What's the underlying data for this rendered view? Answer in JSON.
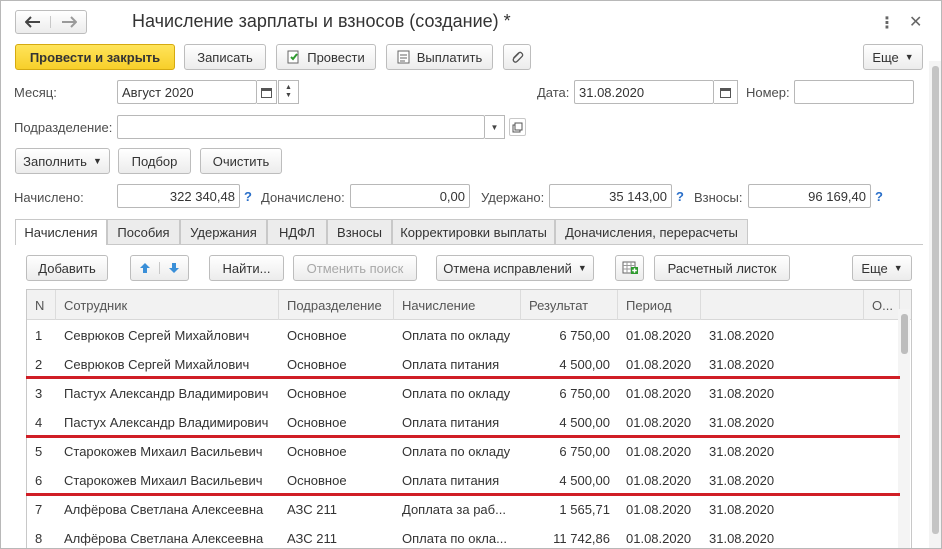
{
  "window": {
    "title": "Начисление зарплаты и взносов (создание) *"
  },
  "toolbar": {
    "post_close": "Провести и закрыть",
    "write": "Записать",
    "post": "Провести",
    "pay": "Выплатить",
    "more": "Еще"
  },
  "form": {
    "month_label": "Месяц:",
    "month_value": "Август 2020",
    "date_label": "Дата:",
    "date_value": "31.08.2020",
    "number_label": "Номер:",
    "number_value": "",
    "department_label": "Подразделение:",
    "department_value": "",
    "fill": "Заполнить",
    "select": "Подбор",
    "clear": "Очистить",
    "accrued_label": "Начислено:",
    "accrued_value": "322 340,48",
    "additional_label": "Доначислено:",
    "additional_value": "0,00",
    "withheld_label": "Удержано:",
    "withheld_value": "35 143,00",
    "contributions_label": "Взносы:",
    "contributions_value": "96 169,40",
    "help": "?"
  },
  "tabs": [
    {
      "label": "Начисления"
    },
    {
      "label": "Пособия"
    },
    {
      "label": "Удержания"
    },
    {
      "label": "НДФЛ"
    },
    {
      "label": "Взносы"
    },
    {
      "label": "Корректировки выплаты"
    },
    {
      "label": "Доначисления, перерасчеты"
    }
  ],
  "table_toolbar": {
    "add": "Добавить",
    "find": "Найти...",
    "cancel_search": "Отменить поиск",
    "cancel_fixes": "Отмена исправлений",
    "payslip": "Расчетный листок",
    "more": "Еще"
  },
  "table": {
    "columns": [
      "N",
      "Сотрудник",
      "Подразделение",
      "Начисление",
      "Результат",
      "Период",
      "",
      "О..."
    ],
    "rows": [
      {
        "n": "1",
        "employee": "Севрюков Сергей Михайлович",
        "dept": "Основное",
        "accrual": "Оплата по окладу",
        "result": "6 750,00",
        "from": "01.08.2020",
        "to": "31.08.2020"
      },
      {
        "n": "2",
        "employee": "Севрюков Сергей Михайлович",
        "dept": "Основное",
        "accrual": "Оплата питания",
        "result": "4 500,00",
        "from": "01.08.2020",
        "to": "31.08.2020"
      },
      {
        "n": "3",
        "employee": "Пастух Александр Владимирович",
        "dept": "Основное",
        "accrual": "Оплата по окладу",
        "result": "6 750,00",
        "from": "01.08.2020",
        "to": "31.08.2020"
      },
      {
        "n": "4",
        "employee": "Пастух Александр Владимирович",
        "dept": "Основное",
        "accrual": "Оплата питания",
        "result": "4 500,00",
        "from": "01.08.2020",
        "to": "31.08.2020"
      },
      {
        "n": "5",
        "employee": "Старокожев Михаил Васильевич",
        "dept": "Основное",
        "accrual": "Оплата по окладу",
        "result": "6 750,00",
        "from": "01.08.2020",
        "to": "31.08.2020"
      },
      {
        "n": "6",
        "employee": "Старокожев Михаил Васильевич",
        "dept": "Основное",
        "accrual": "Оплата питания",
        "result": "4 500,00",
        "from": "01.08.2020",
        "to": "31.08.2020"
      },
      {
        "n": "7",
        "employee": "Алфёрова Светлана Алексеевна",
        "dept": "АЗС 211",
        "accrual": "Доплата за раб...",
        "result": "1 565,71",
        "from": "01.08.2020",
        "to": "31.08.2020"
      },
      {
        "n": "8",
        "employee": "Алфёрова Светлана Алексеевна",
        "dept": "АЗС 211",
        "accrual": "Оплата по окла...",
        "result": "11 742,86",
        "from": "01.08.2020",
        "to": "31.08.2020"
      }
    ]
  },
  "colors": {
    "primary_button": "#f7cf2a",
    "highlight_line": "#d01e26",
    "help": "#2a6fc9",
    "arrow_buttons": "#3a8fd8"
  }
}
